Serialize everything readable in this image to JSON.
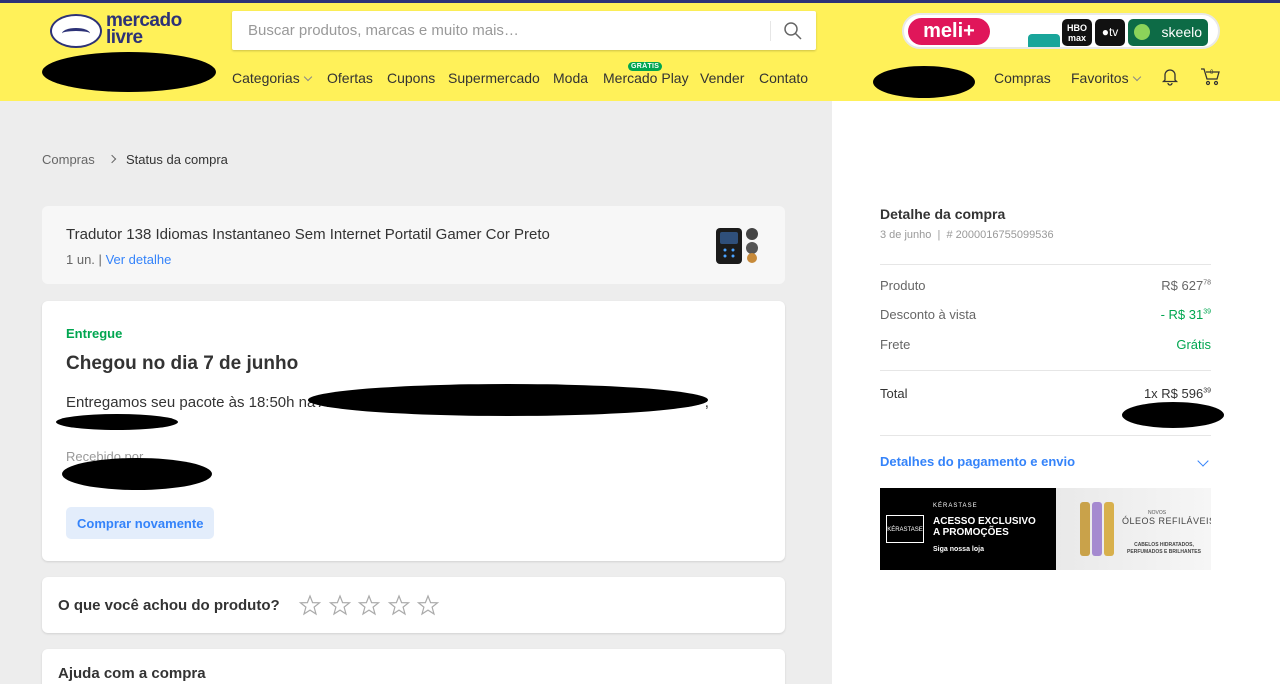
{
  "header": {
    "logo_text": "mercado livre",
    "search_placeholder": "Buscar produtos, marcas e muito mais…",
    "promo": {
      "meli": "meli+",
      "hbo": "HBO max",
      "appletv": "tv",
      "skeelo": "skeelo"
    },
    "nav": [
      "Categorias",
      "Ofertas",
      "Cupons",
      "Supermercado",
      "Moda",
      "Mercado Play",
      "Vender",
      "Contato"
    ],
    "gratis_badge": "GRÁTIS",
    "user_links": [
      "Compras",
      "Favoritos"
    ],
    "icons": [
      "search-icon",
      "bell-icon",
      "cart-icon",
      "chevron-down-icon"
    ]
  },
  "breadcrumb": {
    "parent": "Compras",
    "current": "Status da compra"
  },
  "product": {
    "name": "Tradutor 138 Idiomas Instantaneo Sem Internet Portatil Gamer Cor Preto",
    "qty": "1 un.",
    "sep": "|",
    "detail_link": "Ver detalhe"
  },
  "status": {
    "label": "Entregue",
    "title": "Chegou no dia 7 de junho",
    "description": "Entregamos seu pacote às 18:50h na A",
    "description_tail": ",",
    "received_label": "Recebido por",
    "buy_again": "Comprar novamente"
  },
  "rating": {
    "question": "O que você achou do produto?",
    "stars": 5
  },
  "help": {
    "title": "Ajuda com a compra"
  },
  "detail": {
    "title": "Detalhe da compra",
    "date": "3 de junho",
    "meta_sep": "|",
    "order_id": "# 2000016755099536",
    "rows": [
      {
        "label": "Produto",
        "value": "R$ 627",
        "cents": "78"
      },
      {
        "label": "Desconto à vista",
        "value": "- R$ 31",
        "cents": "39"
      },
      {
        "label": "Frete",
        "value": "Grátis",
        "cents": ""
      }
    ],
    "total_label": "Total",
    "total_value": "1x R$ 596",
    "total_cents": "39",
    "payment_link": "Detalhes do pagamento e envio"
  },
  "ad": {
    "logo": "KÉRASTASE",
    "brand": "KÉRASTASE",
    "headline": "ACESSO EXCLUSIVO A PROMOÇÕES",
    "cta": "Siga nossa loja",
    "right_small": "NOVOS",
    "right_title": "ÓLEOS REFILÁVEIS",
    "right_sub": "CABELOS HIDRATADOS, PERFUMADOS E BRILHANTES"
  },
  "colors": {
    "header_bg": "#fff159",
    "link": "#3483fa",
    "success": "#00a650",
    "brand_dark": "#2d3277"
  }
}
